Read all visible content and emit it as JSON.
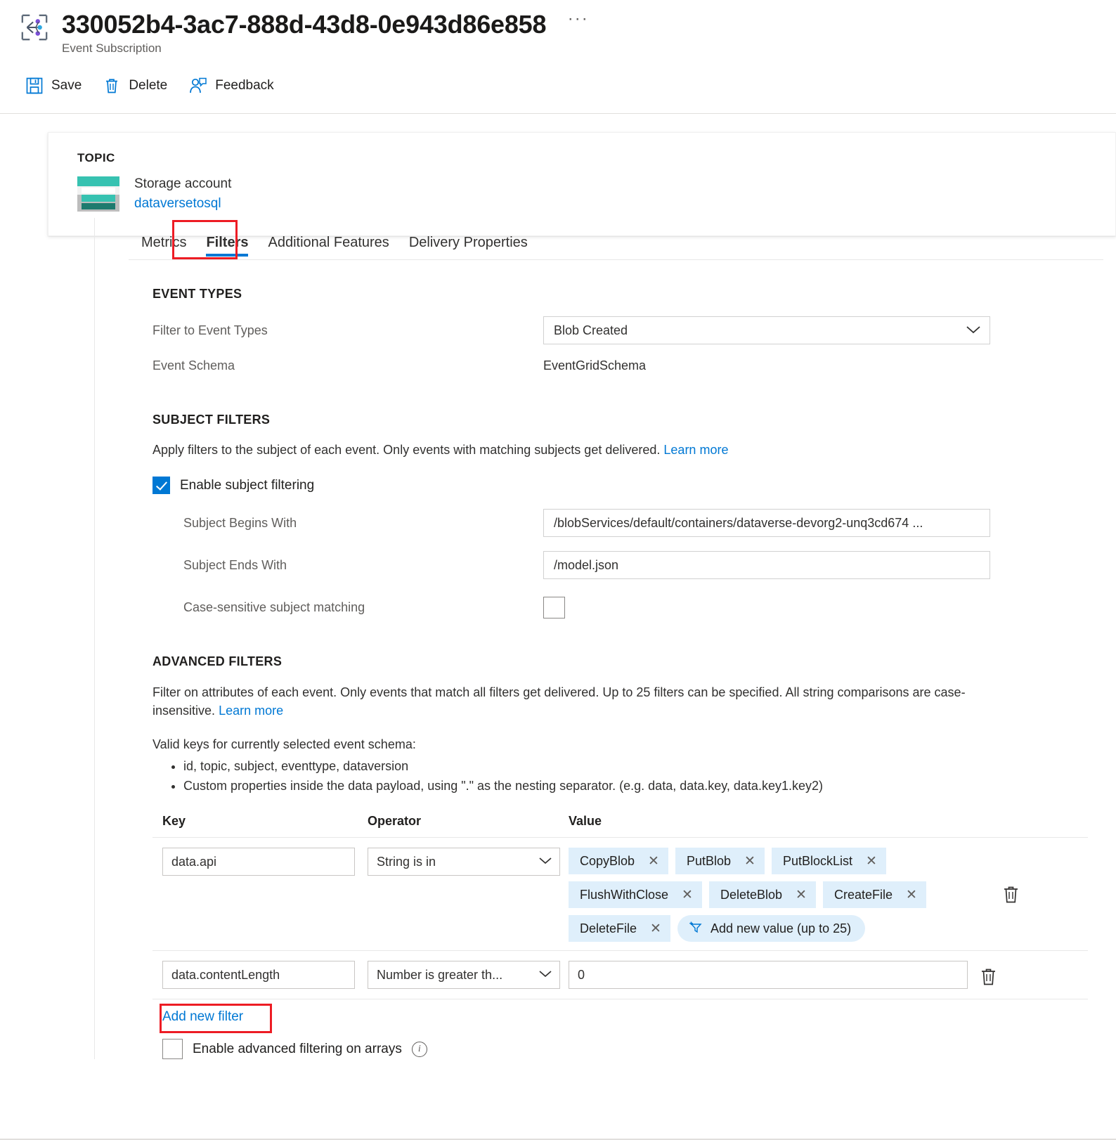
{
  "header": {
    "title": "330052b4-3ac7-888d-43d8-0e943d86e858",
    "subtitle": "Event Subscription",
    "more_label": "···",
    "icon": "event-subscription-icon"
  },
  "commandbar": {
    "items": [
      {
        "label": "Save",
        "icon": "save-icon"
      },
      {
        "label": "Delete",
        "icon": "trash-icon"
      },
      {
        "label": "Feedback",
        "icon": "feedback-person-icon"
      }
    ]
  },
  "topic_card": {
    "heading": "TOPIC",
    "resource_type": "Storage account",
    "resource_name": "dataversetosql",
    "icon": "storage-account-icon"
  },
  "tabs": [
    {
      "label": "Metrics",
      "active": false
    },
    {
      "label": "Filters",
      "active": true
    },
    {
      "label": "Additional Features",
      "active": false
    },
    {
      "label": "Delivery Properties",
      "active": false
    }
  ],
  "event_types": {
    "heading": "EVENT TYPES",
    "filter_label": "Filter to Event Types",
    "filter_value": "Blob Created",
    "schema_label": "Event Schema",
    "schema_value": "EventGridSchema"
  },
  "subject_filters": {
    "heading": "SUBJECT FILTERS",
    "description": "Apply filters to the subject of each event. Only events with matching subjects get delivered.",
    "learn_more": "Learn more",
    "enable_label": "Enable subject filtering",
    "enable_checked": true,
    "begins_label": "Subject Begins With",
    "begins_value": "/blobServices/default/containers/dataverse-devorg2-unq3cd674 ...",
    "ends_label": "Subject Ends With",
    "ends_value": "/model.json",
    "case_label": "Case-sensitive subject matching",
    "case_checked": false
  },
  "advanced_filters": {
    "heading": "ADVANCED FILTERS",
    "description": "Filter on attributes of each event. Only events that match all filters get delivered. Up to 25 filters can be specified. All string comparisons are case-insensitive.",
    "learn_more": "Learn more",
    "valid_keys_intro": "Valid keys for currently selected event schema:",
    "valid_keys": [
      "id, topic, subject, eventtype, dataversion",
      "Custom properties inside the data payload, using \".\" as the nesting separator. (e.g. data, data.key, data.key1.key2)"
    ],
    "columns": {
      "key": "Key",
      "operator": "Operator",
      "value": "Value"
    },
    "rows": [
      {
        "key": "data.api",
        "operator": "String is in",
        "values": [
          "CopyBlob",
          "PutBlob",
          "PutBlockList",
          "FlushWithClose",
          "DeleteBlob",
          "CreateFile",
          "DeleteFile"
        ],
        "add_value_label": "Add new value (up to 25)",
        "add_value_icon": "add-filter-icon",
        "delete_icon": "trash-icon"
      },
      {
        "key": "data.contentLength",
        "operator": "Number is greater th...",
        "value": "0",
        "delete_icon": "trash-icon"
      }
    ],
    "add_filter_label": "Add new filter",
    "arrays_label": "Enable advanced filtering on arrays",
    "arrays_checked": false,
    "arrays_info_icon": "info-icon"
  },
  "annotations": [
    {
      "name": "highlight-filters-tab",
      "color": "#ed1c24"
    },
    {
      "name": "highlight-add-new-filter",
      "color": "#ed1c24"
    }
  ],
  "colors": {
    "accent": "#0078d4",
    "chip_bg": "#dfeffb",
    "annotation": "#ed1c24",
    "storage_teal": "#37c2b1"
  }
}
